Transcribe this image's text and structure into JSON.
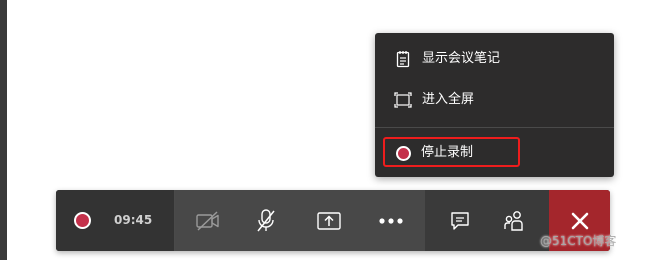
{
  "menu": {
    "items": [
      {
        "label": "显示会议笔记",
        "icon": "notes-icon"
      },
      {
        "label": "进入全屏",
        "icon": "fullscreen-icon"
      },
      {
        "label": "停止录制",
        "icon": "record-stop-icon"
      }
    ]
  },
  "toolbar": {
    "recording_time": "09:45",
    "buttons": [
      {
        "name": "camera-off",
        "icon": "camera-off-icon"
      },
      {
        "name": "mic-muted",
        "icon": "mic-off-icon"
      },
      {
        "name": "share-screen",
        "icon": "share-screen-icon"
      },
      {
        "name": "more-actions",
        "icon": "more-icon"
      },
      {
        "name": "show-conversation",
        "icon": "chat-icon"
      },
      {
        "name": "show-participants",
        "icon": "participants-icon"
      },
      {
        "name": "hang-up",
        "icon": "close-icon"
      }
    ]
  },
  "watermark": "@51CTO博客",
  "colors": {
    "menu_bg": "#2d2c2c",
    "toolbar_bg": "#2b2b2b",
    "controls_bg": "#484848",
    "record_red": "#c4314b",
    "hangup_red": "#a4262c",
    "highlight_red": "#ee1d1d"
  }
}
